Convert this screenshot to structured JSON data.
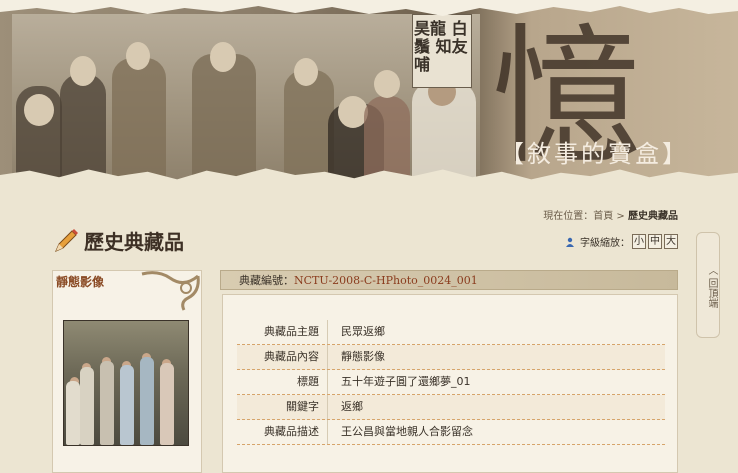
{
  "banner": {
    "poster_text": "昊龍 白鬚 知友 哺",
    "big_char": "憶",
    "title": "【敘事的寶盒】"
  },
  "side_scroll": {
    "label": "回頂端"
  },
  "breadcrumb": {
    "prefix": "現在位置：",
    "home": "首頁",
    "separator": ">",
    "current": "歷史典藏品"
  },
  "font_size": {
    "label": "字級縮放：",
    "options": [
      "小",
      "中",
      "大"
    ]
  },
  "section": {
    "title": "歷史典藏品"
  },
  "left_panel": {
    "title": "靜態影像"
  },
  "record": {
    "id_label": "典藏編號：",
    "id_value": "NCTU-2008-C-HPhoto_0024_001"
  },
  "details": [
    {
      "label": "典藏品主題",
      "value": "民眾返鄉"
    },
    {
      "label": "典藏品內容",
      "value": "靜態影像"
    },
    {
      "label": "標題",
      "value": "五十年遊子圓了還鄉夢_01"
    },
    {
      "label": "關鍵字",
      "value": "返鄉"
    },
    {
      "label": "典藏品描述",
      "value": "王公昌與當地親人合影留念"
    }
  ],
  "colors": {
    "accent": "#8a3c1e",
    "panel_title": "#8a4a24",
    "background": "#ece5d2"
  }
}
